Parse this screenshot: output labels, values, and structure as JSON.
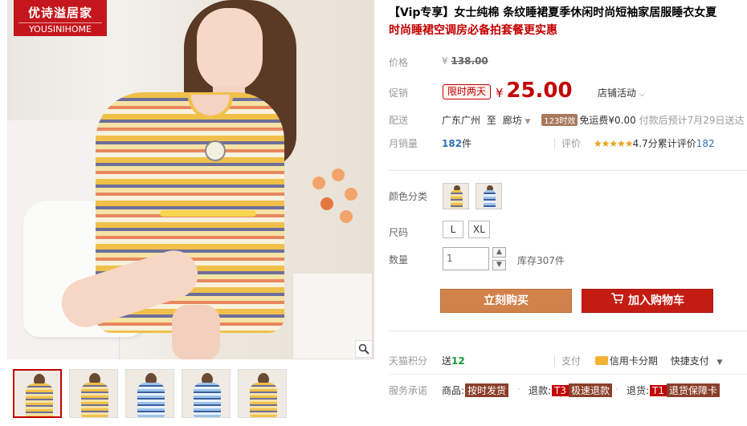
{
  "brand": {
    "name_cn": "优诗溢居家",
    "name_en": "YOUSINIHOME"
  },
  "product": {
    "title_line1": "【Vip专享】女士纯棉 条纹睡裙夏季休闲时尚短袖家居服睡衣女夏",
    "title_line2": "时尚睡裙空调房必备拍套餐更实惠"
  },
  "price": {
    "label": "价格",
    "currency": "¥",
    "original": "138.00",
    "promo_label": "促销",
    "promo_tag": "限时两天",
    "promo_value": "25.00",
    "shop_activity": "店铺活动"
  },
  "delivery": {
    "label": "配送",
    "from": "广东广州",
    "to_word": "至",
    "to": "廊坊",
    "timely_tag": "123时效",
    "shipping": "免运费¥0.00",
    "eta": "付款后预计7月29日送达"
  },
  "sales": {
    "label": "月销量",
    "count": "182",
    "unit": "件",
    "rating_label": "评价",
    "stars": "★★★★★",
    "score": "4.7分",
    "total_label": "累计评价",
    "total": "182"
  },
  "options": {
    "color_label": "颜色分类",
    "size_label": "尺码",
    "sizes": [
      "L",
      "XL"
    ],
    "qty_label": "数量",
    "qty_value": "1",
    "stock": "库存307件"
  },
  "actions": {
    "buy": "立刻购买",
    "cart": "加入购物车"
  },
  "points": {
    "label": "天猫积分",
    "send_word": "送",
    "value": "12",
    "pay_label": "支付",
    "credit": "信用卡分期",
    "quick_pay": "快捷支付"
  },
  "promise": {
    "label": "服务承诺",
    "goods_label": "商品:",
    "goods_tag": "按时发货",
    "refund_label": "退款:",
    "refund_tag_code": "T3",
    "refund_tag": "极速退款",
    "return_label": "退货:",
    "return_tag_code": "T1",
    "return_tag": "退货保障卡"
  },
  "icons": [
    "zoom-icon",
    "chevron-down-icon",
    "cart-icon",
    "credit-card-icon"
  ]
}
